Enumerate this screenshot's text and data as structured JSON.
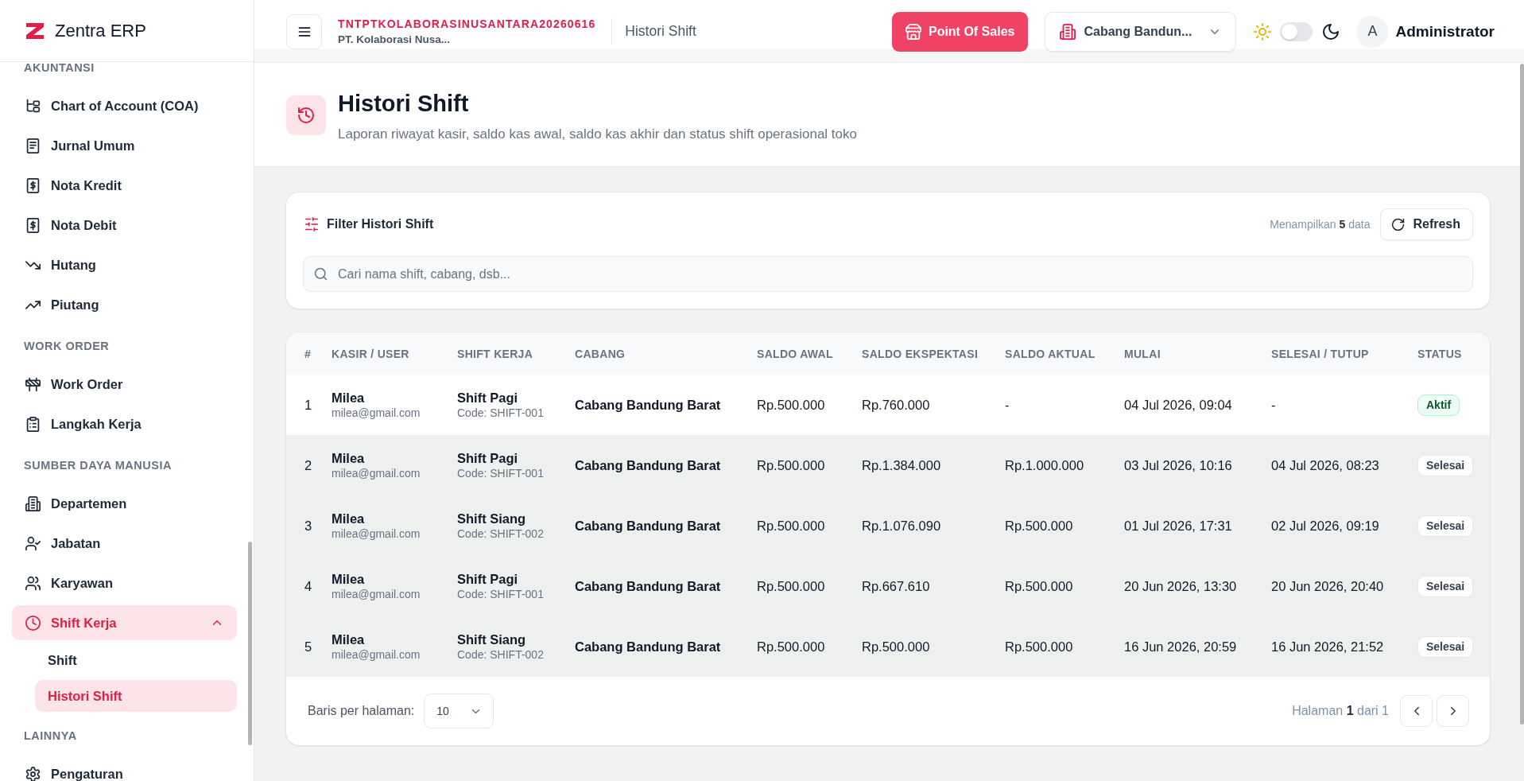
{
  "sidebar": {
    "brand": "Zentra ERP",
    "sections": [
      {
        "label": "AKUNTANSI",
        "items": [
          {
            "label": "Chart of Account (COA)",
            "selected": false
          },
          {
            "label": "Jurnal Umum",
            "selected": false
          },
          {
            "label": "Nota Kredit",
            "selected": false
          },
          {
            "label": "Nota Debit",
            "selected": false
          },
          {
            "label": "Hutang",
            "selected": false
          },
          {
            "label": "Piutang",
            "selected": false
          }
        ]
      },
      {
        "label": "WORK ORDER",
        "items": [
          {
            "label": "Work Order",
            "selected": false
          },
          {
            "label": "Langkah Kerja",
            "selected": false
          }
        ]
      },
      {
        "label": "SUMBER DAYA MANUSIA",
        "items": [
          {
            "label": "Departemen",
            "selected": false
          },
          {
            "label": "Jabatan",
            "selected": false
          },
          {
            "label": "Karyawan",
            "selected": false
          },
          {
            "label": "Shift Kerja",
            "selected": true,
            "expanded": true,
            "children": [
              {
                "label": "Shift",
                "selected": false
              },
              {
                "label": "Histori Shift",
                "selected": true
              }
            ]
          }
        ]
      },
      {
        "label": "LAINNYA",
        "items": [
          {
            "label": "Pengaturan",
            "selected": false
          }
        ]
      }
    ]
  },
  "topbar": {
    "company_code": "TNTPTKOLABORASINUSANTARA20260616",
    "company_name": "PT. Kolaborasi Nusa...",
    "breadcrumb": "Histori Shift",
    "pos_button": "Point Of Sales",
    "branch_select": {
      "value": "Cabang Bandun..."
    },
    "theme_toggle": {
      "on": false
    },
    "user": {
      "avatar": "A",
      "name": "Administrator"
    }
  },
  "page_header": {
    "title": "Histori Shift",
    "subtitle": "Laporan riwayat kasir, saldo kas awal, saldo kas akhir dan status shift operasional toko"
  },
  "filter": {
    "title": "Filter Histori Shift",
    "result_count": "Menampilkan **5** data",
    "refresh_button": "Refresh",
    "search": {
      "placeholder": "Cari nama shift, cabang, dsb..."
    }
  },
  "table": {
    "columns": [
      "#",
      "KASIR / USER",
      "SHIFT KERJA",
      "CABANG",
      "SALDO AWAL",
      "SALDO EKSPEKTASI",
      "SALDO AKTUAL",
      "MULAI",
      "SELESAI / TUTUP",
      "STATUS"
    ],
    "rows": [
      {
        "no": "1",
        "cashier": {
          "name": "Milea",
          "email": "milea@gmail.com"
        },
        "shift": {
          "name": "Shift Pagi",
          "code": "Code: SHIFT-001"
        },
        "branch": "Cabang Bandung Barat",
        "opening": "Rp.500.000",
        "expected": "Rp.760.000",
        "actual": "-",
        "start": "04 Jul 2026, 09:04",
        "end": "-",
        "status": {
          "label": "Aktif",
          "active": true
        },
        "shaded": false
      },
      {
        "no": "2",
        "cashier": {
          "name": "Milea",
          "email": "milea@gmail.com"
        },
        "shift": {
          "name": "Shift Pagi",
          "code": "Code: SHIFT-001"
        },
        "branch": "Cabang Bandung Barat",
        "opening": "Rp.500.000",
        "expected": "Rp.1.384.000",
        "actual": "Rp.1.000.000",
        "start": "03 Jul 2026, 10:16",
        "end": "04 Jul 2026, 08:23",
        "status": {
          "label": "Selesai",
          "active": false
        },
        "shaded": true
      },
      {
        "no": "3",
        "cashier": {
          "name": "Milea",
          "email": "milea@gmail.com"
        },
        "shift": {
          "name": "Shift Siang",
          "code": "Code: SHIFT-002"
        },
        "branch": "Cabang Bandung Barat",
        "opening": "Rp.500.000",
        "expected": "Rp.1.076.090",
        "actual": "Rp.500.000",
        "start": "01 Jul 2026, 17:31",
        "end": "02 Jul 2026, 09:19",
        "status": {
          "label": "Selesai",
          "active": false
        },
        "shaded": true
      },
      {
        "no": "4",
        "cashier": {
          "name": "Milea",
          "email": "milea@gmail.com"
        },
        "shift": {
          "name": "Shift Pagi",
          "code": "Code: SHIFT-001"
        },
        "branch": "Cabang Bandung Barat",
        "opening": "Rp.500.000",
        "expected": "Rp.667.610",
        "actual": "Rp.500.000",
        "start": "20 Jun 2026, 13:30",
        "end": "20 Jun 2026, 20:40",
        "status": {
          "label": "Selesai",
          "active": false
        },
        "shaded": true
      },
      {
        "no": "5",
        "cashier": {
          "name": "Milea",
          "email": "milea@gmail.com"
        },
        "shift": {
          "name": "Shift Siang",
          "code": "Code: SHIFT-002"
        },
        "branch": "Cabang Bandung Barat",
        "opening": "Rp.500.000",
        "expected": "Rp.500.000",
        "actual": "Rp.500.000",
        "start": "16 Jun 2026, 20:59",
        "end": "16 Jun 2026, 21:52",
        "status": {
          "label": "Selesai",
          "active": false
        },
        "shaded": true
      }
    ]
  },
  "pagination": {
    "rows_per_page_label": "Baris per halaman:",
    "rows_per_page": "10",
    "page_info": "Halaman **1** dari 1"
  }
}
